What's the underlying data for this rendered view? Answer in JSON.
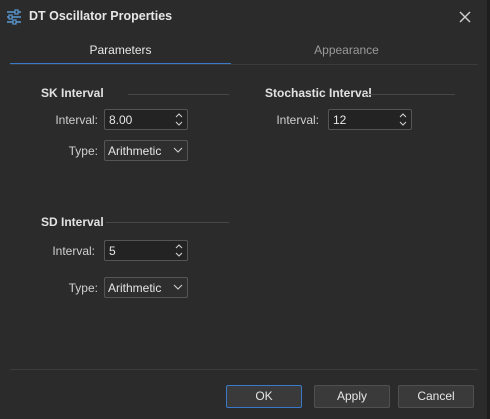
{
  "window": {
    "title": "DT Oscillator Properties",
    "title_icon": "sliders-icon",
    "close_icon": "close-icon"
  },
  "tabs": [
    {
      "label": "Parameters",
      "active": true
    },
    {
      "label": "Appearance",
      "active": false
    }
  ],
  "sk_interval": {
    "title": "SK Interval",
    "interval_label": "Interval:",
    "interval_value": "8.00",
    "type_label": "Type:",
    "type_value": "Arithmetic"
  },
  "stochastic_interval": {
    "title": "Stochastic Interval",
    "interval_label": "Interval:",
    "interval_value": "12"
  },
  "sd_interval": {
    "title": "SD Interval",
    "interval_label": "Interval:",
    "interval_value": "5",
    "type_label": "Type:",
    "type_value": "Arithmetic"
  },
  "buttons": {
    "ok": "OK",
    "apply": "Apply",
    "cancel": "Cancel"
  },
  "colors": {
    "background": "#2b2b2b",
    "accent": "#3a78c9"
  }
}
